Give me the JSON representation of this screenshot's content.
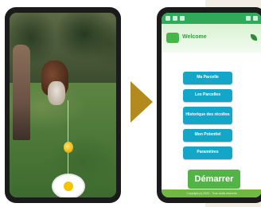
{
  "app": {
    "title": "Welcome"
  },
  "menu": {
    "items": [
      {
        "label": "Ma Parcelle"
      },
      {
        "label": "Les Parcelles"
      },
      {
        "label": "Historique des récoltes"
      },
      {
        "label": "Mon Potentiel"
      },
      {
        "label": "Paramètres"
      }
    ]
  },
  "actions": {
    "start_label": "Démarrer"
  },
  "footer": {
    "text": "Copyright (c) 2022 - Tous droits réservés"
  },
  "colors": {
    "menu_button": "#14a6c8",
    "start_button": "#52b447",
    "status_bar": "#2eaa5a",
    "arrow": "#b28a1e"
  },
  "icons": [
    "arrow-right-icon",
    "app-logo-icon",
    "leaf-icon"
  ]
}
